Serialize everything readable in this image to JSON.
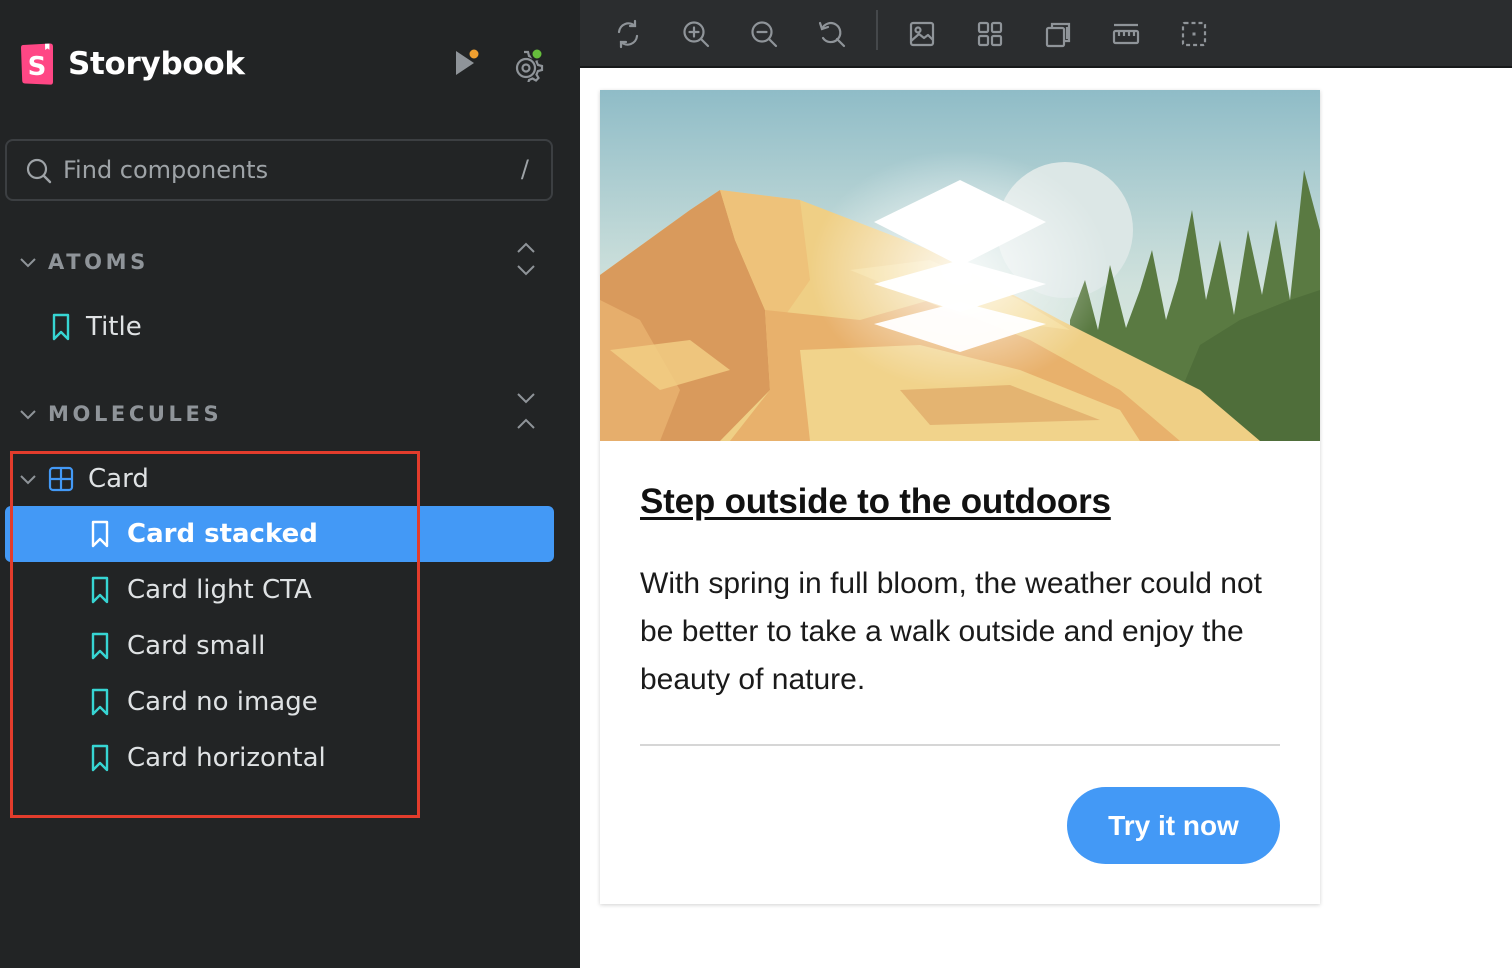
{
  "app": {
    "name": "Storybook",
    "brand_color": "#ff4785",
    "accent_color": "#4399f6"
  },
  "sidebar": {
    "search": {
      "placeholder": "Find components",
      "shortcut": "/"
    },
    "groups": [
      {
        "label": "ATOMS",
        "items": [
          {
            "label": "Title",
            "type": "story"
          }
        ]
      },
      {
        "label": "MOLECULES",
        "component": {
          "label": "Card",
          "expanded": true,
          "stories": [
            {
              "label": "Card stacked",
              "selected": true
            },
            {
              "label": "Card light CTA",
              "selected": false
            },
            {
              "label": "Card small",
              "selected": false
            },
            {
              "label": "Card no image",
              "selected": false
            },
            {
              "label": "Card horizontal",
              "selected": false
            }
          ]
        }
      }
    ]
  },
  "toolbar": {
    "icons": [
      "reload-icon",
      "zoom-in-icon",
      "zoom-out-icon",
      "reset-zoom-icon",
      "background-icon",
      "grid-icon",
      "viewport-icon",
      "measure-icon",
      "outline-icon"
    ]
  },
  "preview": {
    "card": {
      "title": "Step outside to the outdoors",
      "body": "With spring in full bloom, the weather could not be better to take a walk outside and enjoy the beauty of nature.",
      "cta": "Try it now"
    }
  }
}
